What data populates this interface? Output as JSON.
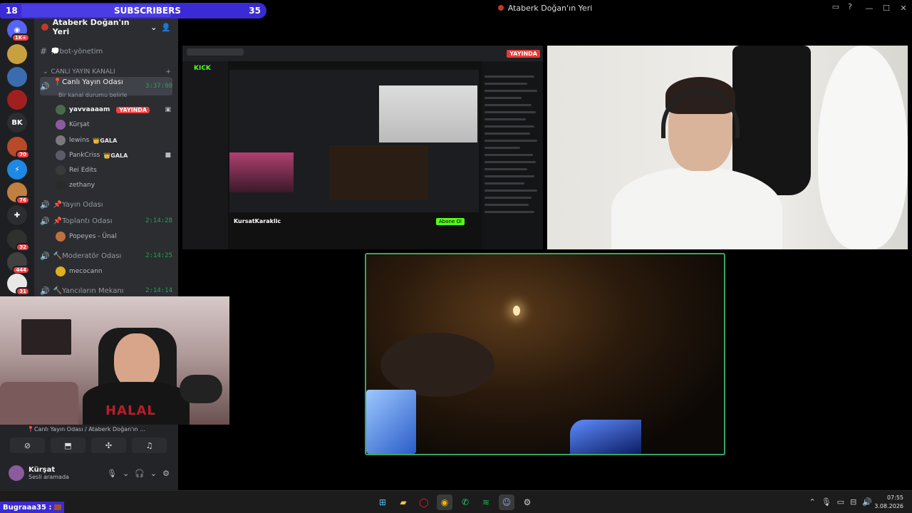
{
  "overlay": {
    "subs_current": "18",
    "subs_label": "SUBSCRIBERS",
    "subs_goal": "35"
  },
  "window": {
    "title": "Ataberk Doğan'ın Yeri"
  },
  "server_rail": [
    {
      "badge": "1K+"
    },
    {
      "badge": ""
    },
    {
      "badge": ""
    },
    {
      "badge": ""
    },
    {
      "label": "BK",
      "badge": ""
    },
    {
      "badge": "70"
    },
    {
      "badge": ""
    },
    {
      "badge": "76"
    },
    {
      "badge": ""
    },
    {
      "badge": "32"
    },
    {
      "badge": "444"
    },
    {
      "badge": "31"
    }
  ],
  "guild": {
    "name": "Ataberk Doğan'ın Yeri"
  },
  "channels": {
    "bot_channel": "💭bot-yönetim",
    "category": "CANLI YAYIN KANALI",
    "live_room": {
      "name": "📍Canlı Yayın Odası",
      "time": "3:37:00",
      "status": "Bir kanal durumu belirle"
    },
    "live_users": [
      {
        "name": "yavvaaaam",
        "live": "YAYINDA"
      },
      {
        "name": "Kürşat"
      },
      {
        "name": "lewins",
        "tag": "👑GALA"
      },
      {
        "name": "PankCriss",
        "tag": "👑GALA"
      },
      {
        "name": "Rei Edits"
      },
      {
        "name": "zethany"
      }
    ],
    "stream_room": "📌Yayın Odası",
    "meeting_room": {
      "name": "📌Toplantı Odası",
      "time": "2:14:28"
    },
    "meeting_users": [
      {
        "name": "Popeyes - Ünal"
      }
    ],
    "mod_room": {
      "name": "🔨Moderatör Odası",
      "time": "2:14:25"
    },
    "mod_users": [
      {
        "name": "mecocann"
      }
    ],
    "helpers_room": {
      "name": "🔨Yancıların Mekanı",
      "time": "2:14:14"
    }
  },
  "voice_panel": {
    "location": "📍Canlı Yayın Odası / Ataberk Doğan'ın ...",
    "user_name": "Kürşat",
    "user_status": "Sesli aramada"
  },
  "stream1": {
    "brand": "KICK",
    "live": "YAYINDA",
    "streamer": "KursatKaraklic",
    "follow": "Abone Ol"
  },
  "cam_shirt": "HALAL",
  "taskbar": {
    "ticker_user": "Bugraaa35 :",
    "time": "07:55",
    "date": "3.08.2026"
  },
  "colors": {
    "accent": "#3b2bd6",
    "live_red": "#f23f43",
    "voice_green": "#23a559",
    "kick_green": "#53fc18"
  }
}
